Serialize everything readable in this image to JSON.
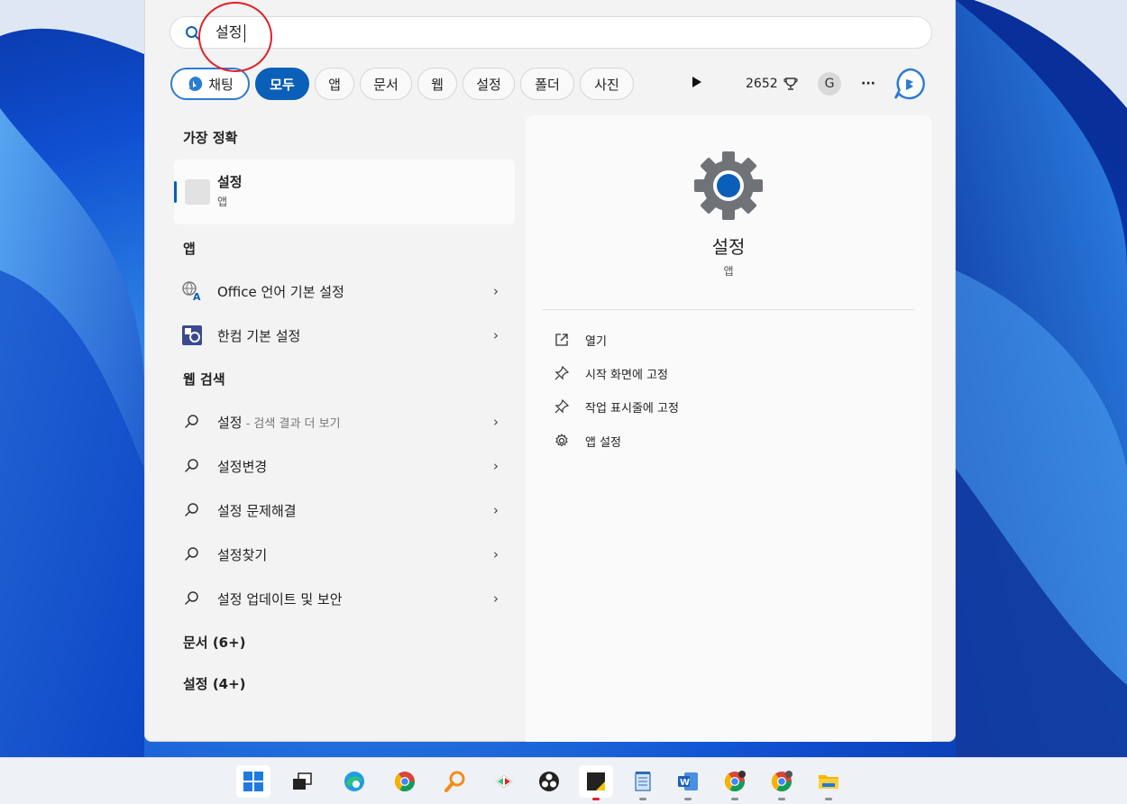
{
  "search": {
    "query": "설정"
  },
  "chips": {
    "chat": "채팅",
    "all": "모두",
    "apps": "앱",
    "documents": "문서",
    "web": "웹",
    "settings": "설정",
    "folders": "폴더",
    "photos": "사진",
    "points": "2652",
    "avatar_letter": "G",
    "more": "···"
  },
  "left": {
    "best_match_heading": "가장 정확",
    "best_match": {
      "title": "설정",
      "subtitle": "앱"
    },
    "apps_heading": "앱",
    "apps": [
      {
        "label": "Office 언어 기본 설정"
      },
      {
        "label": "한컴 기본 설정"
      }
    ],
    "web_heading": "웹 검색",
    "web": [
      {
        "label": "설정",
        "sub": "- 검색 결과 더 보기"
      },
      {
        "label": "설정변경"
      },
      {
        "label": "설정 문제해결"
      },
      {
        "label": "설정찾기"
      },
      {
        "label": "설정 업데이트 및 보안"
      }
    ],
    "documents_heading": "문서 (6+)",
    "settings_heading": "설정 (4+)",
    "chevron": "›"
  },
  "right": {
    "title": "설정",
    "subtitle": "앱",
    "actions": [
      {
        "label": "열기"
      },
      {
        "label": "시작 화면에 고정"
      },
      {
        "label": "작업 표시줄에 고정"
      },
      {
        "label": "앱 설정"
      }
    ]
  },
  "colors": {
    "accent": "#0a5fb8",
    "annotation": "#e0202a"
  }
}
